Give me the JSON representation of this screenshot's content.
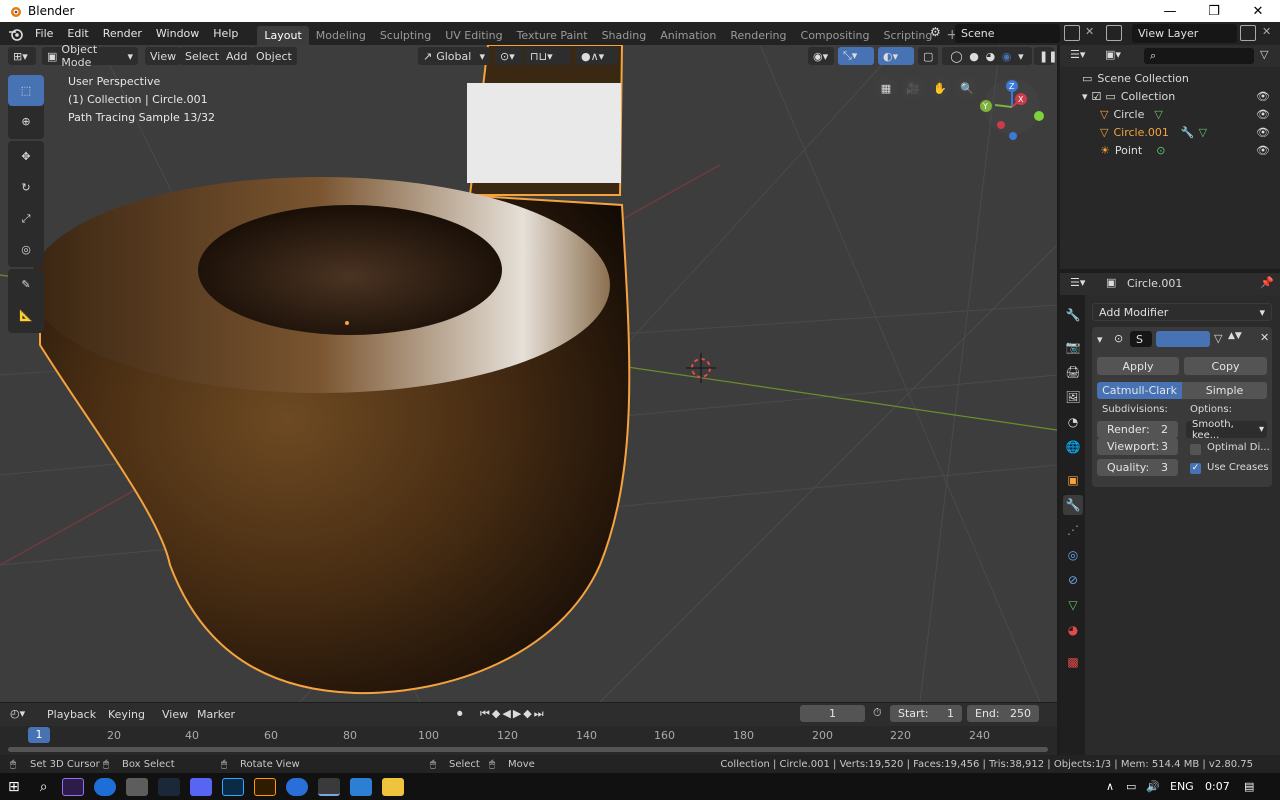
{
  "window": {
    "title": "Blender",
    "minimize": "—",
    "maximize": "❐",
    "close": "✕"
  },
  "menu": [
    "File",
    "Edit",
    "Render",
    "Window",
    "Help"
  ],
  "workspaces": [
    {
      "label": "Layout",
      "active": true
    },
    {
      "label": "Modeling"
    },
    {
      "label": "Sculpting"
    },
    {
      "label": "UV Editing"
    },
    {
      "label": "Texture Paint"
    },
    {
      "label": "Shading"
    },
    {
      "label": "Animation"
    },
    {
      "label": "Rendering"
    },
    {
      "label": "Compositing"
    },
    {
      "label": "Scripting"
    }
  ],
  "add_workspace": "+",
  "scene": {
    "name": "Scene",
    "view_layer": "View Layer"
  },
  "viewport_header": {
    "mode": "Object Mode",
    "menus": [
      "View",
      "Select",
      "Add",
      "Object"
    ],
    "orientation": "Global"
  },
  "overlay_text": {
    "line1": "User Perspective",
    "line2": "(1) Collection | Circle.001",
    "line3": "Path Tracing Sample 13/32"
  },
  "gizmo": {
    "x": "X",
    "y": "Y",
    "z": "Z"
  },
  "outliner": {
    "search_placeholder": "",
    "items": [
      {
        "label": "Scene Collection"
      },
      {
        "label": "Collection"
      },
      {
        "label": "Circle"
      },
      {
        "label": "Circle.001",
        "selected": true
      },
      {
        "label": "Point"
      }
    ]
  },
  "properties": {
    "object_name": "Circle.001",
    "add_modifier": "Add Modifier",
    "modifier_name": "S",
    "apply": "Apply",
    "copy": "Copy",
    "tabs": [
      "Catmull-Clark",
      "Simple"
    ],
    "subdivisions_label": "Subdivisions:",
    "options_label": "Options:",
    "render_label": "Render:",
    "render_value": "2",
    "viewport_label": "Viewport:",
    "viewport_value": "3",
    "quality_label": "Quality:",
    "quality_value": "3",
    "uv_smooth": "Smooth, kee...",
    "optimal_display": "Optimal Di...",
    "use_creases": "Use Creases",
    "optimal_checked": false,
    "creases_checked": true
  },
  "timeline": {
    "menus": [
      "Playback",
      "Keying",
      "View",
      "Marker"
    ],
    "current_frame": "1",
    "start_label": "Start:",
    "start": "1",
    "end_label": "End:",
    "end": "250",
    "ruler": [
      "1",
      "20",
      "40",
      "60",
      "80",
      "100",
      "120",
      "140",
      "160",
      "180",
      "200",
      "220",
      "240"
    ]
  },
  "statusbar": {
    "hint1": "Set 3D Cursor",
    "hint2": "Box Select",
    "hint3": "Rotate View",
    "hint4": "Select",
    "hint5": "Move",
    "info": "Collection | Circle.001 | Verts:19,520 | Faces:19,456 | Tris:38,912 | Objects:1/3 | Mem: 514.4 MB | v2.80.75"
  },
  "taskbar": {
    "lang": "ENG",
    "time": "0:07"
  },
  "colors": {
    "accent": "#4772b3",
    "selection": "#f5a33d",
    "axis_x": "#cc3b4a",
    "axis_y": "#7fb13c",
    "axis_z": "#3c78d8"
  }
}
